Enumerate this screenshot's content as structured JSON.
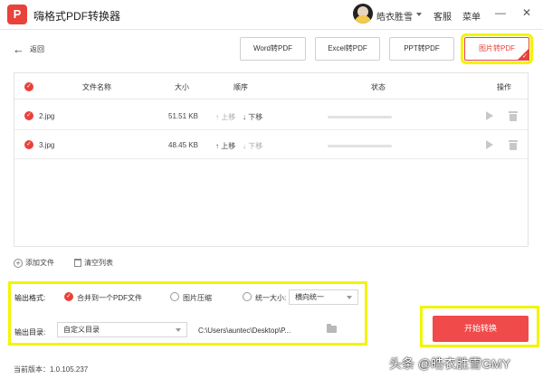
{
  "app": {
    "logo_text": "P",
    "title": "嗨格式PDF转换器",
    "user_name": "皓衣胜雪",
    "service_label": "客服",
    "menu_label": "菜单",
    "minimize_glyph": "—",
    "close_glyph": "✕"
  },
  "nav": {
    "back_label": "返回",
    "back_arrow": "←"
  },
  "conversion_tabs": [
    {
      "label": "Word转PDF",
      "active": false
    },
    {
      "label": "Excel转PDF",
      "active": false
    },
    {
      "label": "PPT转PDF",
      "active": false
    },
    {
      "label": "图片转PDF",
      "active": true
    }
  ],
  "table": {
    "headers": {
      "name": "文件名称",
      "size": "大小",
      "order": "顺序",
      "status": "状态",
      "action": "操作"
    },
    "rows": [
      {
        "name": "2.jpg",
        "size": "51.51 KB",
        "up": "↑ 上移",
        "down": "↓ 下移",
        "up_enabled": false,
        "progress": 0
      },
      {
        "name": "3.jpg",
        "size": "48.45 KB",
        "up": "↑ 上移",
        "down": "↓ 下移",
        "up_enabled": true,
        "progress": 0
      }
    ]
  },
  "toolbar": {
    "add_file": "添加文件",
    "clear_list": "清空列表"
  },
  "options": {
    "format_label": "输出格式:",
    "merge_option": "合并到一个PDF文件",
    "compress_option": "图片压缩",
    "uniform_size_option": "统一大小:",
    "uniform_size_value": "横向统一",
    "dir_label": "输出目录:",
    "dir_select_value": "自定义目录",
    "dir_path": "C:\\Users\\auntec\\Desktop\\P..."
  },
  "start_button": "开始转换",
  "version": "当前版本：1.0.105.237",
  "watermark": "头条 @皓衣胜雪GMY",
  "colors": {
    "accent": "#e8423a",
    "highlight": "#f2f500",
    "start_button": "#f04a4a"
  }
}
